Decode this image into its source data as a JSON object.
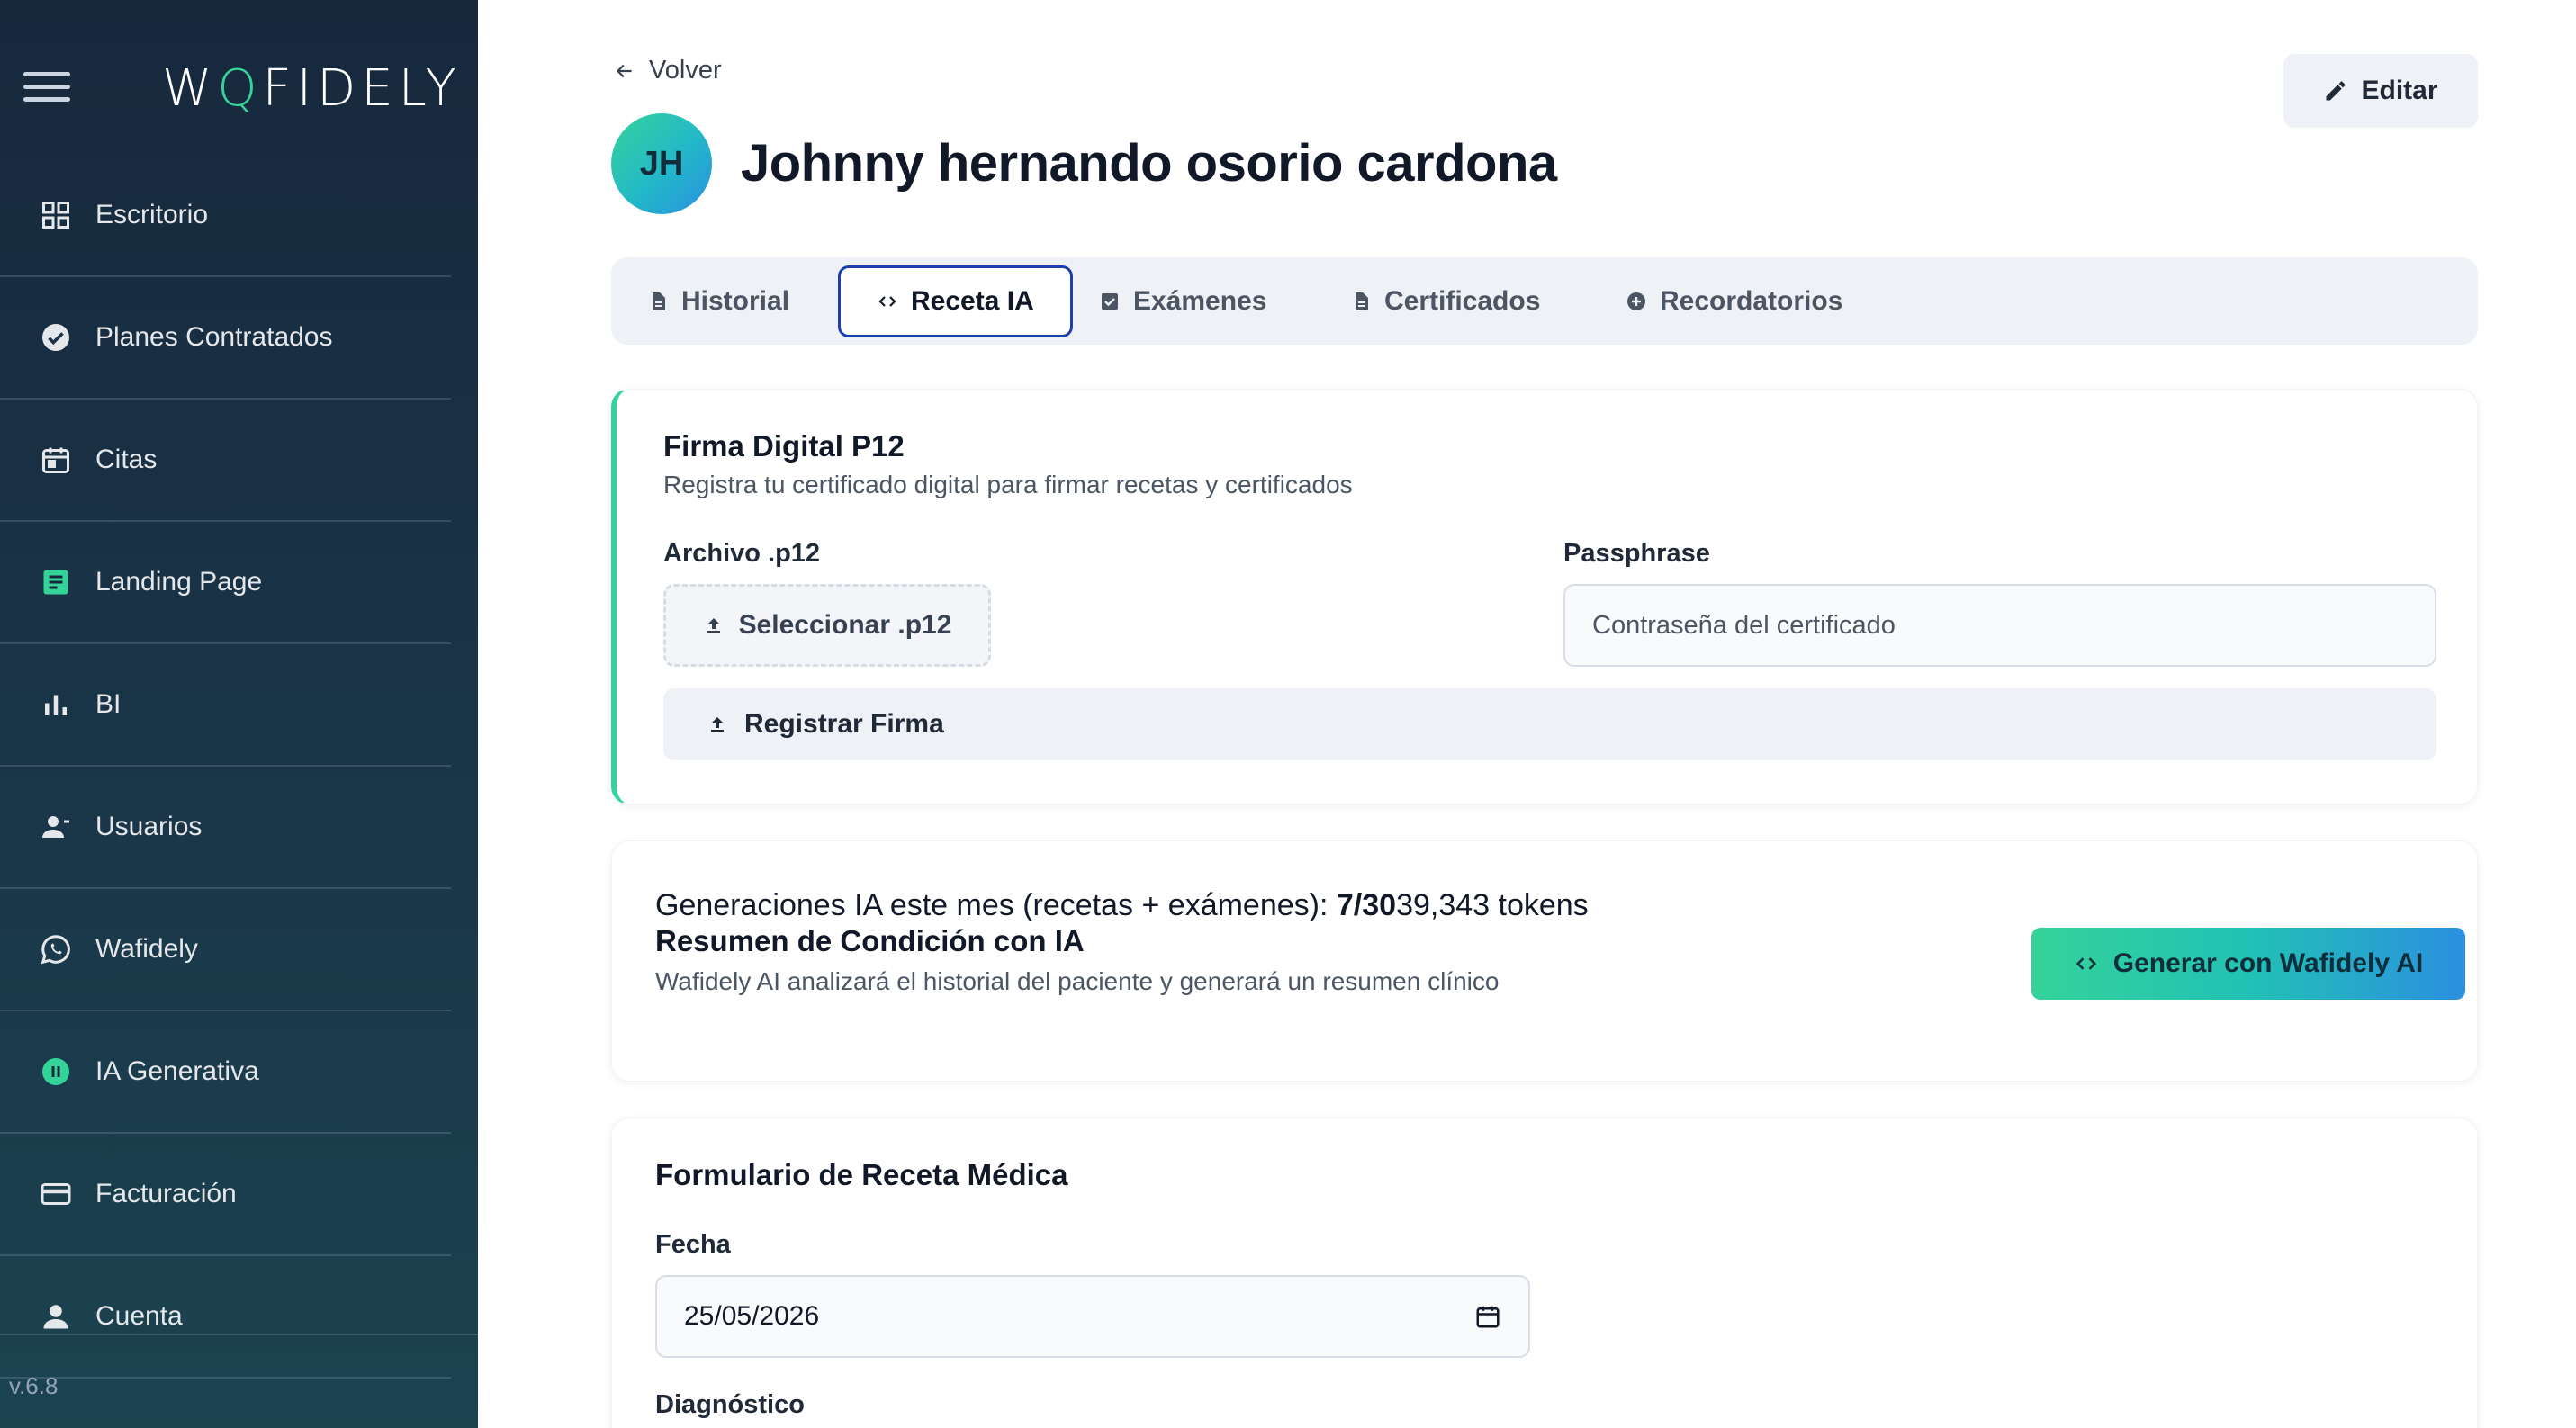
{
  "sidebar": {
    "logo_pre": "W",
    "logo_o": "Q",
    "logo_post": "FIDELY",
    "items": [
      {
        "label": "Escritorio",
        "icon": "grid-icon"
      },
      {
        "label": "Planes Contratados",
        "icon": "check-circle-icon"
      },
      {
        "label": "Citas",
        "icon": "calendar-icon"
      },
      {
        "label": "Landing Page",
        "icon": "document-icon"
      },
      {
        "label": "BI",
        "icon": "bar-chart-icon"
      },
      {
        "label": "Usuarios",
        "icon": "person-add-icon"
      },
      {
        "label": "Wafidely",
        "icon": "whatsapp-icon"
      },
      {
        "label": "IA Generativa",
        "icon": "ai-pause-icon"
      },
      {
        "label": "Facturación",
        "icon": "credit-card-icon"
      },
      {
        "label": "Cuenta",
        "icon": "person-icon"
      }
    ],
    "version": "v.6.8",
    "colors": {
      "accent": "#34d399",
      "background": "#17283d"
    }
  },
  "header": {
    "back_label": "Volver",
    "edit_label": "Editar",
    "avatar_initials": "JH",
    "patient_name": "Johnny hernando osorio cardona"
  },
  "tabs": [
    {
      "label": "Historial",
      "icon": "document-icon",
      "active": false
    },
    {
      "label": "Receta IA",
      "icon": "code-icon",
      "active": true
    },
    {
      "label": "Exámenes",
      "icon": "checkbox-icon",
      "active": false
    },
    {
      "label": "Certificados",
      "icon": "document-icon",
      "active": false
    },
    {
      "label": "Recordatorios",
      "icon": "plus-circle-icon",
      "active": false
    }
  ],
  "firma": {
    "title": "Firma Digital P12",
    "subtitle": "Registra tu certificado digital para firmar recetas y certificados",
    "archivo_label": "Archivo .p12",
    "select_button": "Seleccionar .p12",
    "passphrase_label": "Passphrase",
    "passphrase_placeholder": "Contraseña del certificado",
    "passphrase_value": "",
    "register_button": "Registrar Firma"
  },
  "ia": {
    "generations_prefix": "Generaciones IA este mes (recetas + exámenes): ",
    "generations_count": "7/30",
    "tokens": "39,343 tokens",
    "title": "Resumen de Condición con IA",
    "subtitle": "Wafidely AI analizará el historial del paciente y generará un resumen clínico",
    "button": "Generar con Wafidely AI"
  },
  "receta": {
    "title": "Formulario de Receta Médica",
    "fecha_label": "Fecha",
    "fecha_value": "25/05/2026",
    "diagnostico_label": "Diagnóstico"
  }
}
